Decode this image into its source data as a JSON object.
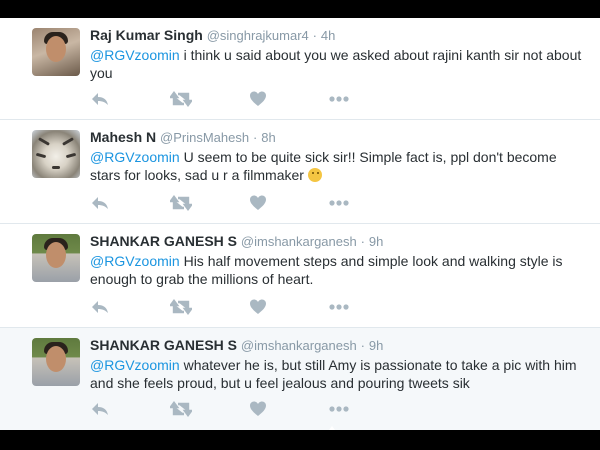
{
  "tweets": [
    {
      "name": "Raj Kumar Singh",
      "handle": "@singhrajkumar4",
      "separator": "·",
      "time": "4h",
      "mention": "@RGVzoomin",
      "text": " i think u said about you we asked about rajini kanth sir not about you",
      "emoji": ""
    },
    {
      "name": "Mahesh N",
      "handle": "@PrinsMahesh",
      "separator": "·",
      "time": "8h",
      "mention": "@RGVzoomin",
      "text": " U seem to be quite sick sir!! Simple fact is, ppl don't become stars for looks, sad u r a filmmaker ",
      "emoji": "thinking-face-emoji"
    },
    {
      "name": "SHANKAR GANESH S",
      "handle": "@imshankarganesh",
      "separator": "·",
      "time": "9h",
      "mention": "@RGVzoomin",
      "text": " His half movement steps and simple look and walking style is enough to grab the millions of heart.",
      "emoji": ""
    },
    {
      "name": "SHANKAR GANESH S",
      "handle": "@imshankarganesh",
      "separator": "·",
      "time": "9h",
      "mention": "@RGVzoomin",
      "text": " whatever he is, but still Amy is passionate to take a pic with him and she feels proud, but u feel jealous and pouring tweets sik",
      "emoji": ""
    }
  ],
  "actions": [
    "reply-icon",
    "retweet-icon",
    "like-heart-icon",
    "more-dots-icon"
  ],
  "colors": {
    "mention": "#1b95e0",
    "name": "#292f33",
    "meta": "#8899a6",
    "icon": "#aab8c2",
    "divider": "#e1e8ed",
    "highlight_bg": "#f5f8fa"
  }
}
